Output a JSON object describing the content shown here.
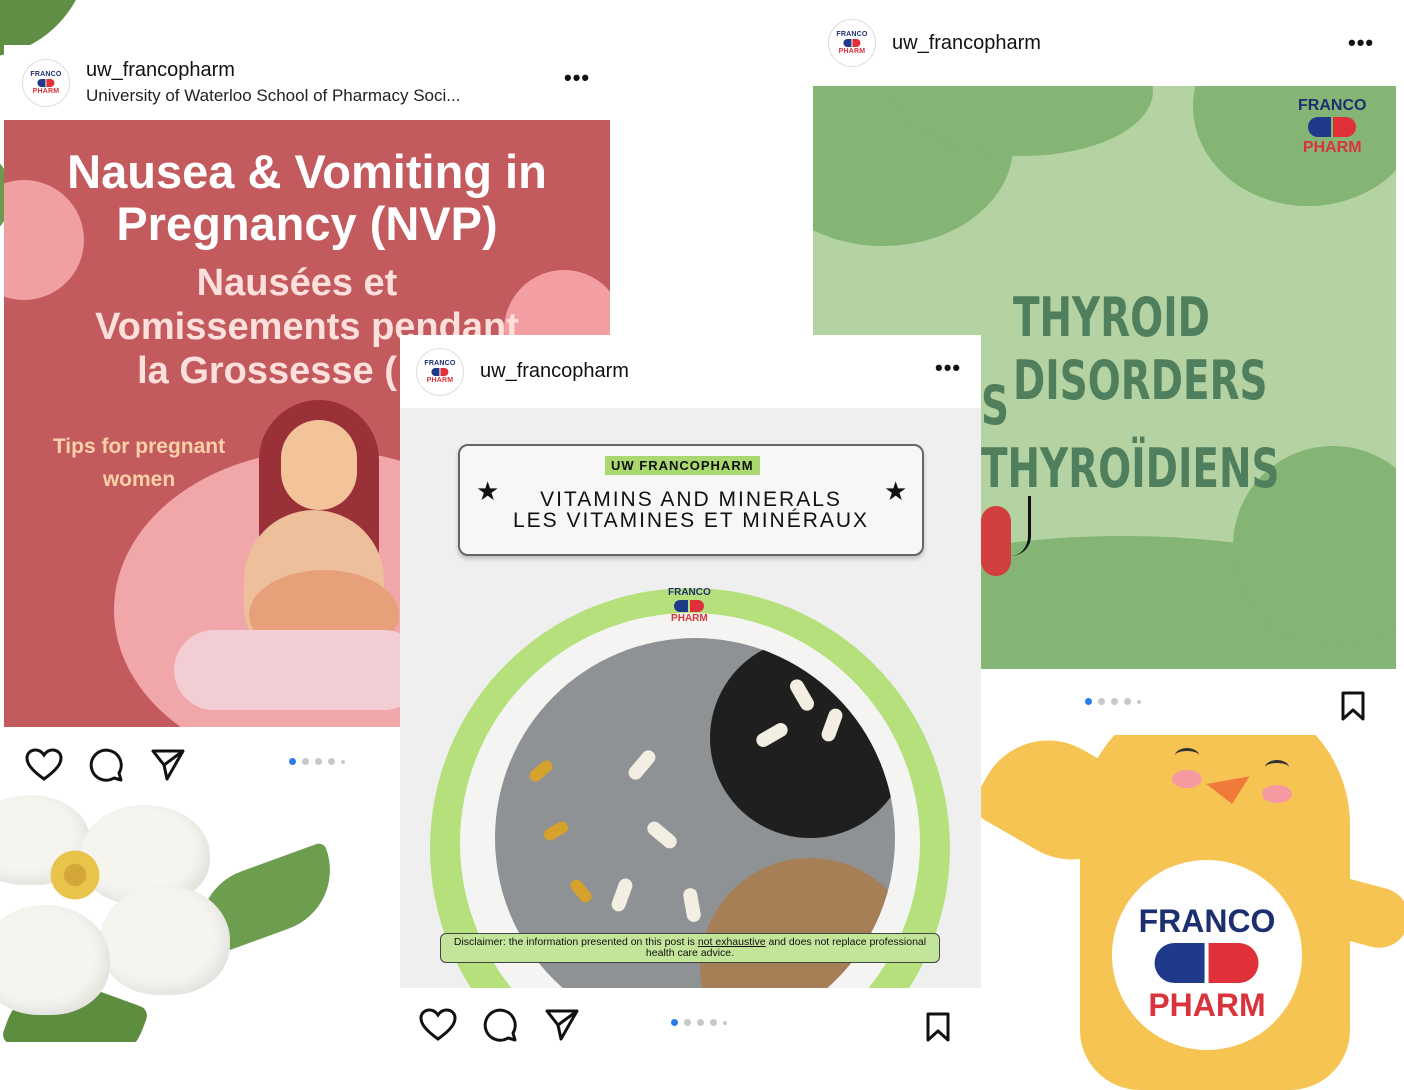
{
  "logo": {
    "top": "FRANCO",
    "bottom": "PHARM"
  },
  "post1": {
    "handle": "uw_francopharm",
    "subtitle": "University of Waterloo School of Pharmacy Soci...",
    "title_line1": "Nausea & Vomiting in",
    "title_line2": "Pregnancy (NVP)",
    "fr_line1": "Nausées et",
    "fr_line2": "Vomissements pendant",
    "fr_line3": "la Grossesse (",
    "tips": "Tips for pregnant women",
    "more": "•••",
    "carousel": {
      "count": 5,
      "active": 0
    }
  },
  "post2": {
    "handle": "uw_francopharm",
    "line1": "THYROID DISORDERS",
    "line2": "S THYROÏDIENS",
    "more": "•••",
    "carousel": {
      "count": 5,
      "active": 0
    }
  },
  "post3": {
    "handle": "uw_francopharm",
    "tag": "UW FRANCOPHARM",
    "line1": "VITAMINS AND MINERALS",
    "line2": "LES VITAMINES ET MINÉRAUX",
    "disclaimer_pre": "Disclaimer: the information presented on this post is ",
    "disclaimer_underlined": "not exhaustive",
    "disclaimer_post": " and does not replace professional health care advice.",
    "more": "•••",
    "carousel": {
      "count": 5,
      "active": 0
    }
  },
  "icons": [
    "heart-icon",
    "comment-icon",
    "share-icon",
    "bookmark-icon",
    "star-icon"
  ],
  "colors": {
    "brand_blue": "#1f3a8a",
    "brand_red": "#e0303a",
    "nvp_bg": "#c35a5e",
    "thyroid_bg": "#b4d2a2",
    "vitamin_green": "#b5e07c",
    "carousel_active": "#2a7ce8"
  }
}
